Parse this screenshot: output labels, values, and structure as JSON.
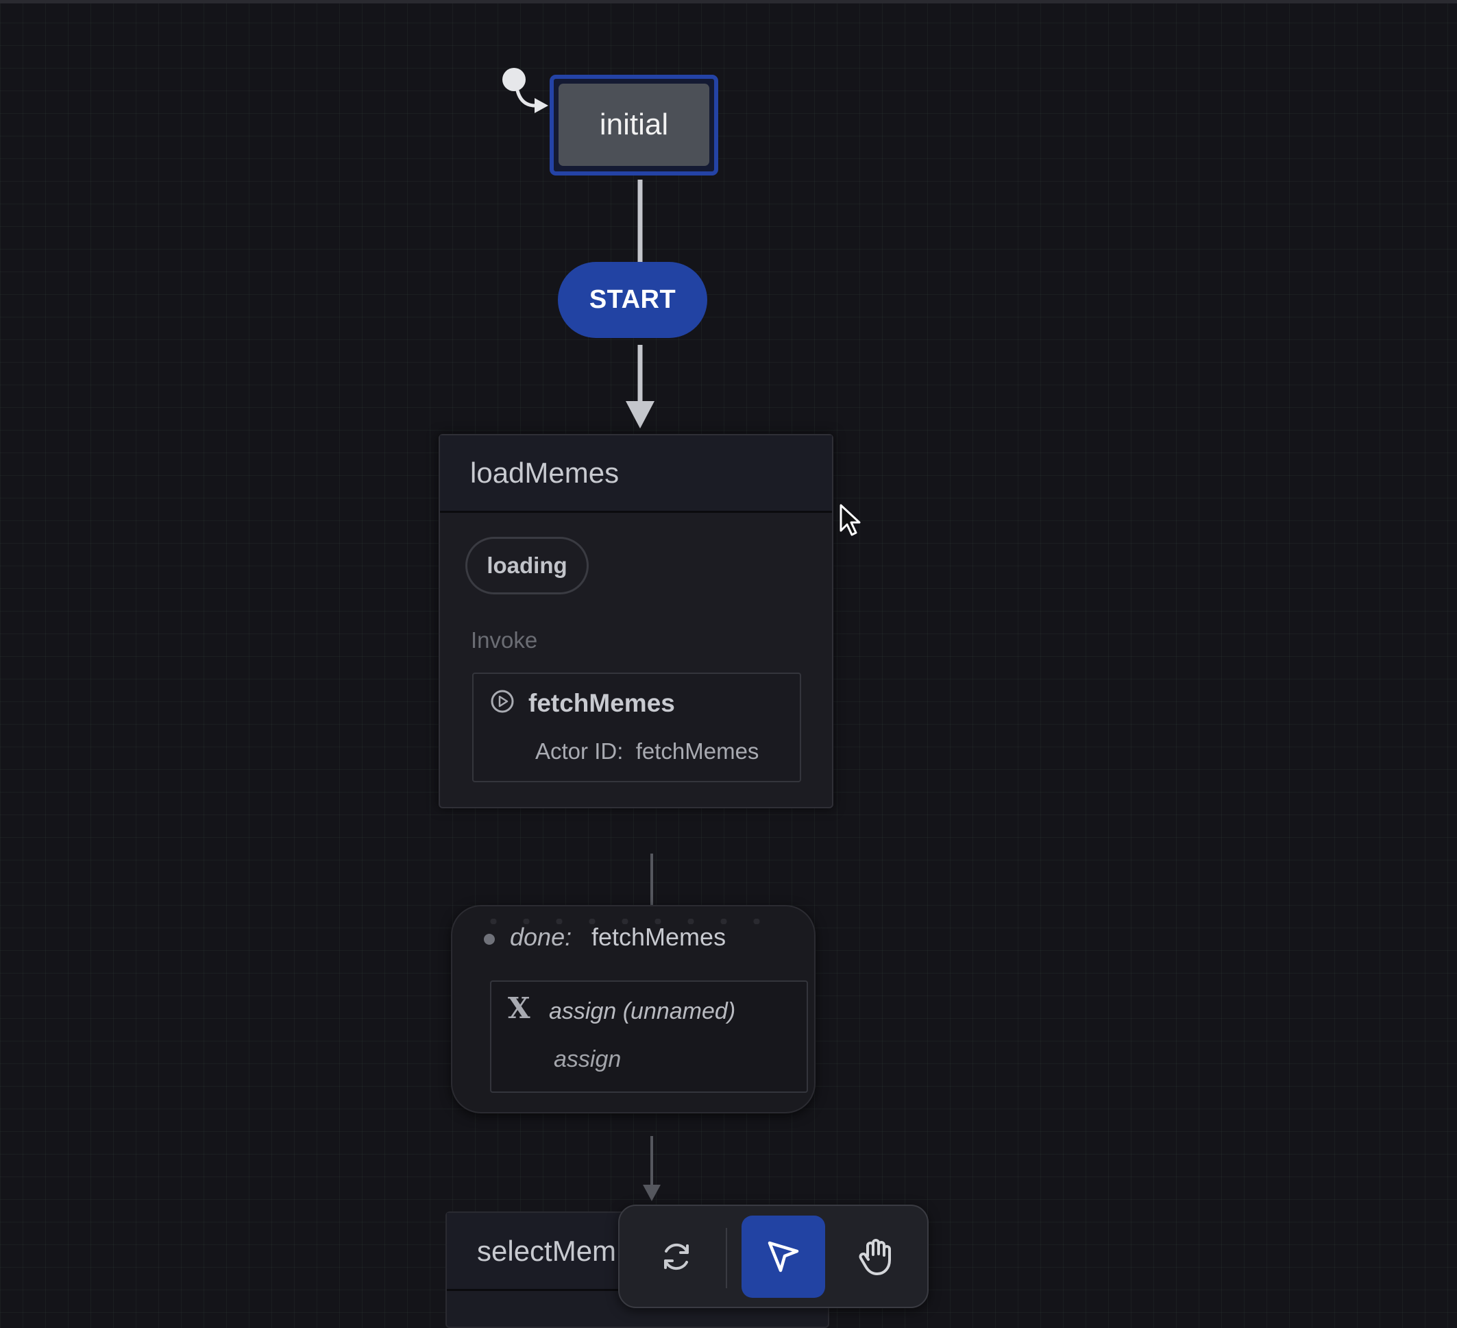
{
  "states": {
    "initial": {
      "label": "initial"
    },
    "loadMemes": {
      "title": "loadMemes",
      "tag": "loading",
      "invoke_section_label": "Invoke",
      "invoke": {
        "name": "fetchMemes",
        "actor_id_label": "Actor ID:",
        "actor_id": "fetchMemes"
      }
    },
    "selectMeme": {
      "title": "selectMem"
    }
  },
  "transitions": {
    "start": {
      "label": "START"
    },
    "done": {
      "event_type": "done:",
      "event_target": "fetchMemes",
      "action": {
        "icon": "X",
        "name": "assign (unnamed)",
        "type": "assign"
      }
    }
  },
  "toolbar": {
    "tools": [
      {
        "name": "reset",
        "icon": "refresh-icon",
        "active": false
      },
      {
        "name": "select",
        "icon": "cursor-arrow-icon",
        "active": true
      },
      {
        "name": "pan",
        "icon": "hand-icon",
        "active": false
      }
    ]
  },
  "colors": {
    "background": "#141419",
    "active_blue": "#2243a3",
    "state_fill": "#1c1c22",
    "edge": "#c4c6cc"
  }
}
